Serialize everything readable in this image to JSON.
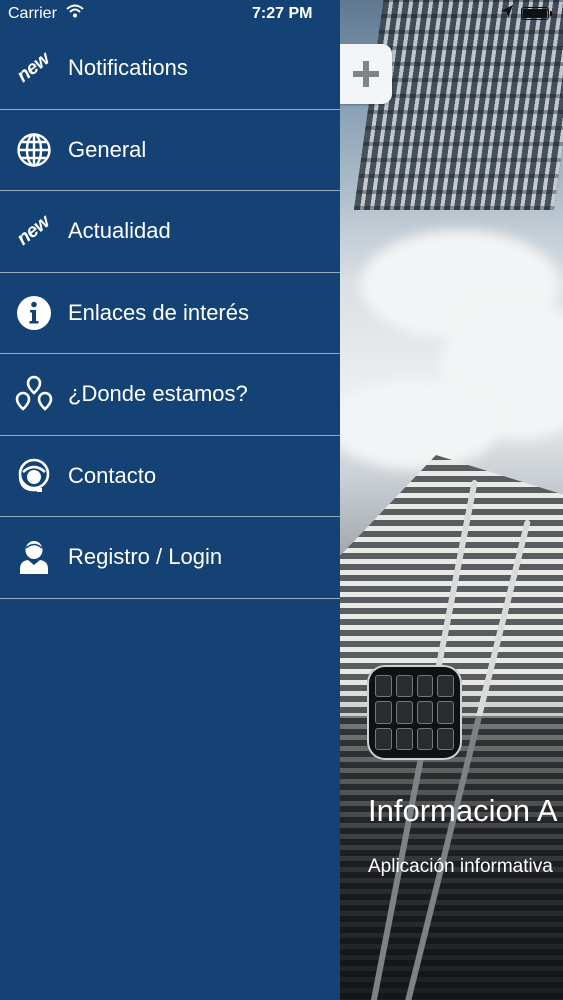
{
  "status_bar": {
    "carrier": "Carrier",
    "time": "7:27 PM"
  },
  "menu": {
    "items": [
      {
        "label": "Notifications",
        "icon": "new-badge-icon",
        "icon_text": "new"
      },
      {
        "label": "General",
        "icon": "globe-icon"
      },
      {
        "label": "Actualidad",
        "icon": "new-badge-icon",
        "icon_text": "new"
      },
      {
        "label": "Enlaces de interés",
        "icon": "info-icon"
      },
      {
        "label": "¿Donde estamos?",
        "icon": "map-pins-icon"
      },
      {
        "label": "Contacto",
        "icon": "headset-icon"
      },
      {
        "label": "Registro / Login",
        "icon": "user-icon"
      }
    ]
  },
  "content": {
    "title": "Informacion A",
    "subtitle": "Aplicación informativa"
  },
  "colors": {
    "drawer_bg": "#144274",
    "text": "#ffffff"
  }
}
